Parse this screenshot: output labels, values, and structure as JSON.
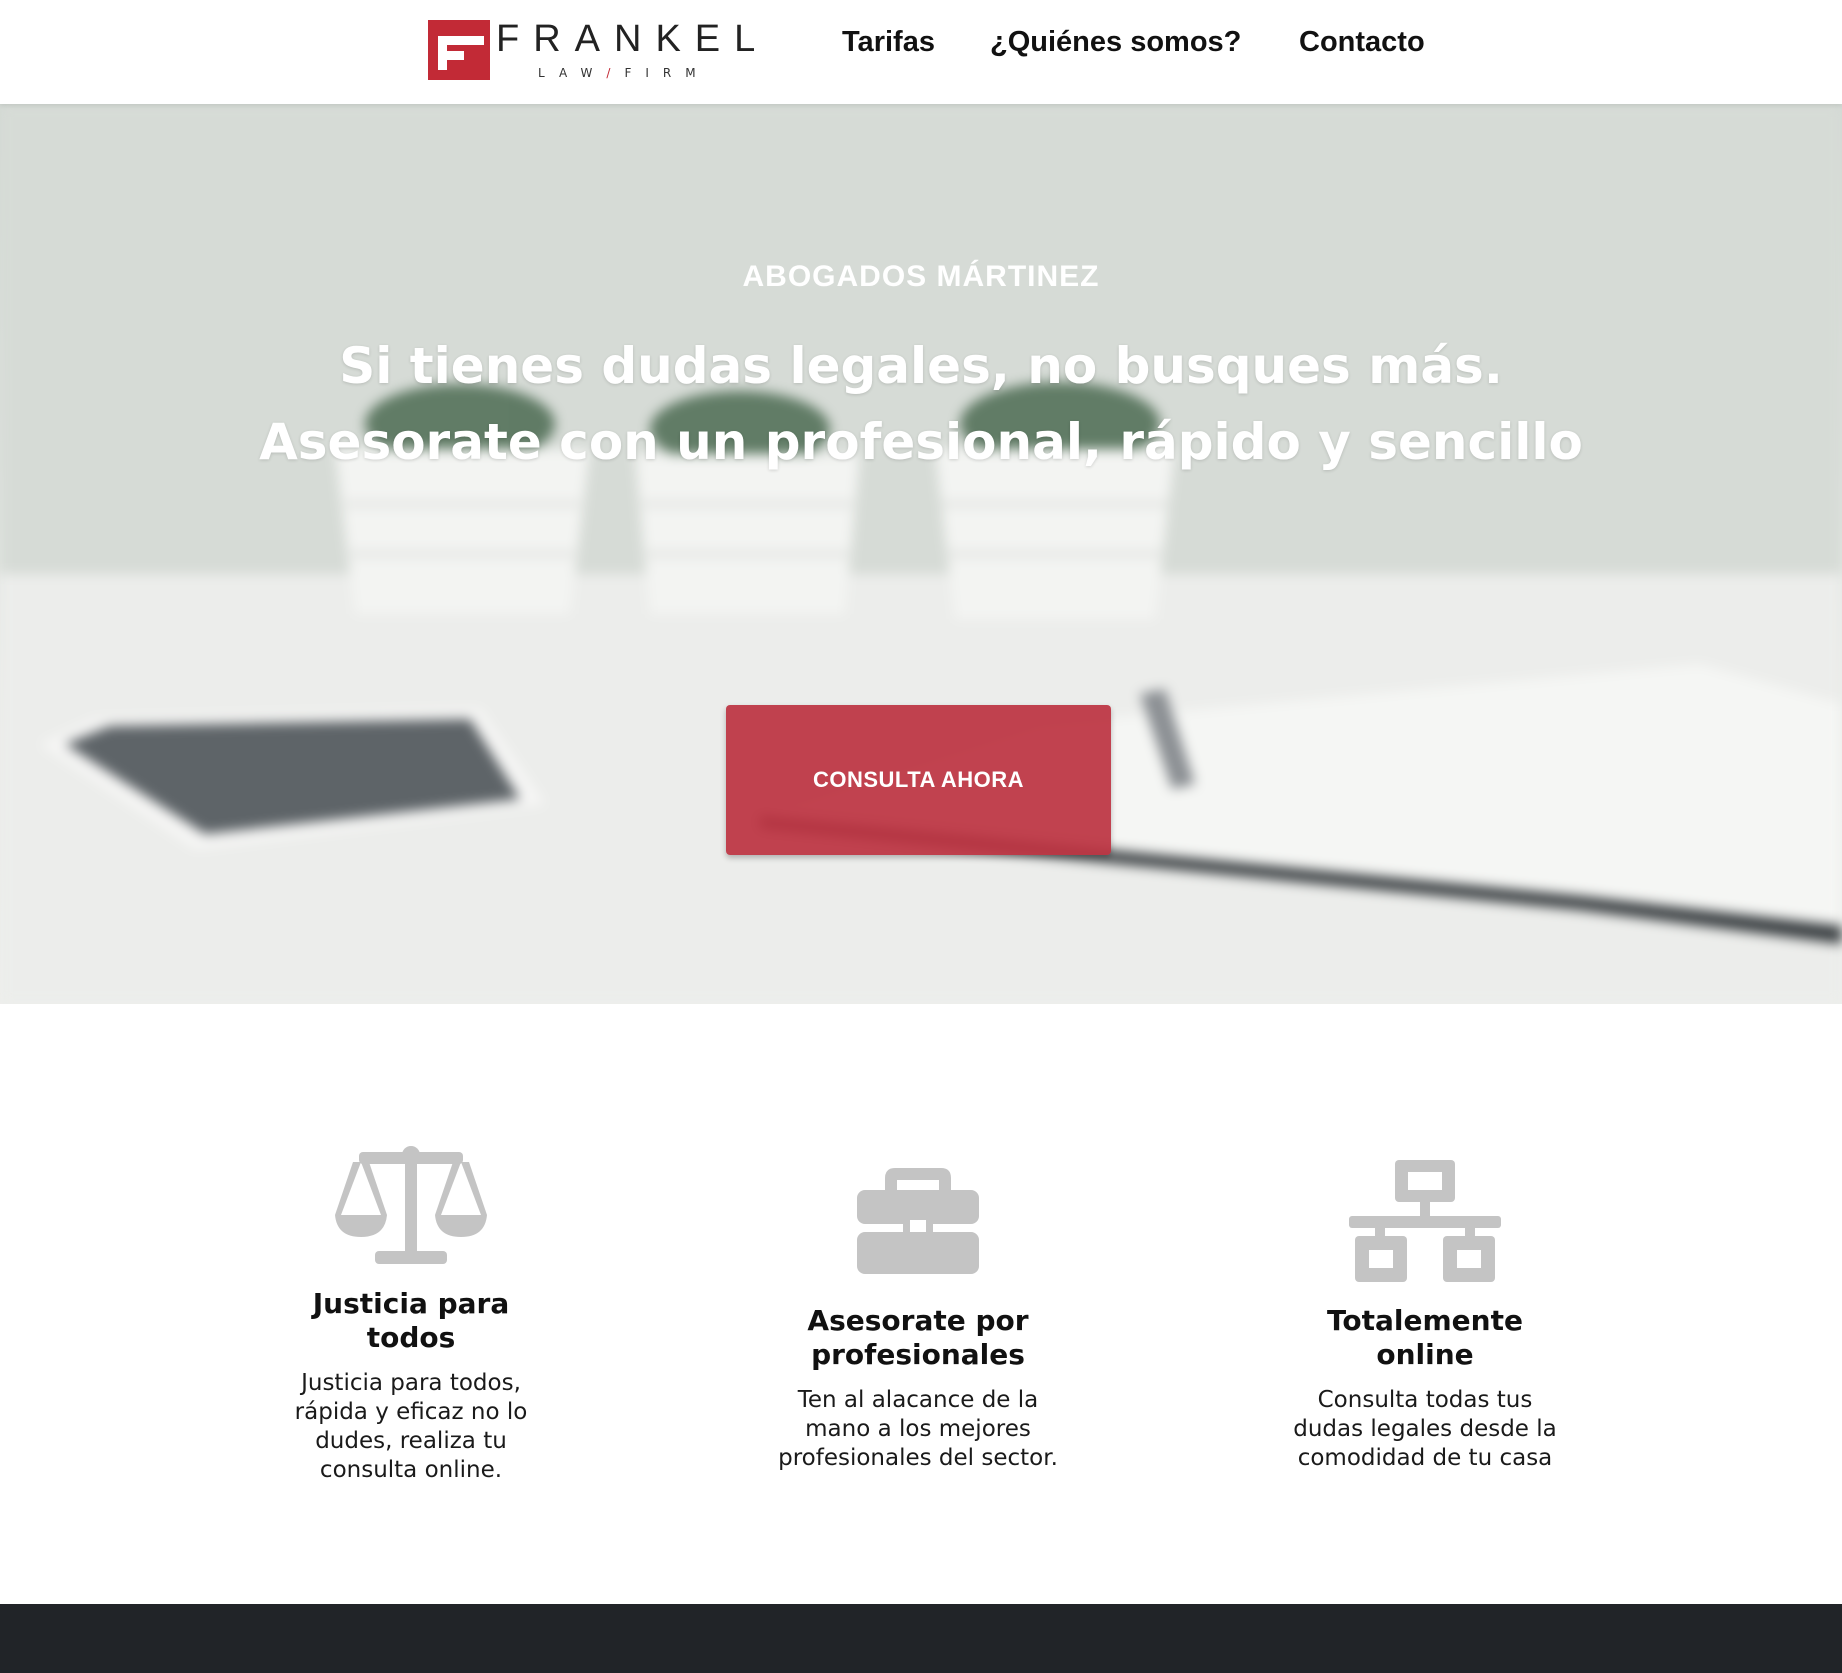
{
  "header": {
    "logo": {
      "word": "FRANKEL",
      "sub_left": "LAW",
      "sub_slash": "/",
      "sub_right": "FIRM",
      "brand_color": "#c22a36"
    },
    "nav": [
      {
        "label": "Tarifas"
      },
      {
        "label": "¿Quiénes somos?"
      },
      {
        "label": "Contacto"
      }
    ]
  },
  "hero": {
    "eyebrow": "ABOGADOS MÁRTINEZ",
    "title_line1": "Si tienes dudas legales, no busques más.",
    "title_line2": "Asesorate con un profesional, rápido y sencillo",
    "cta_label": "CONSULTA AHORA",
    "cta_color": "#bc3442"
  },
  "features": [
    {
      "icon": "scale-icon",
      "title": "Justicia para todos",
      "text": "Justicia para todos, rápida y eficaz no lo dudes, realiza tu consulta online."
    },
    {
      "icon": "briefcase-icon",
      "title": "Asesorate por profesionales",
      "text": "Ten al alacance de la mano a los mejores profesionales del sector."
    },
    {
      "icon": "network-icon",
      "title": "Totalemente online",
      "text": "Consulta todas tus dudas legales desde la comodidad de tu casa"
    }
  ],
  "colors": {
    "icon_gray": "#c4c4c4",
    "footer": "#212428"
  }
}
